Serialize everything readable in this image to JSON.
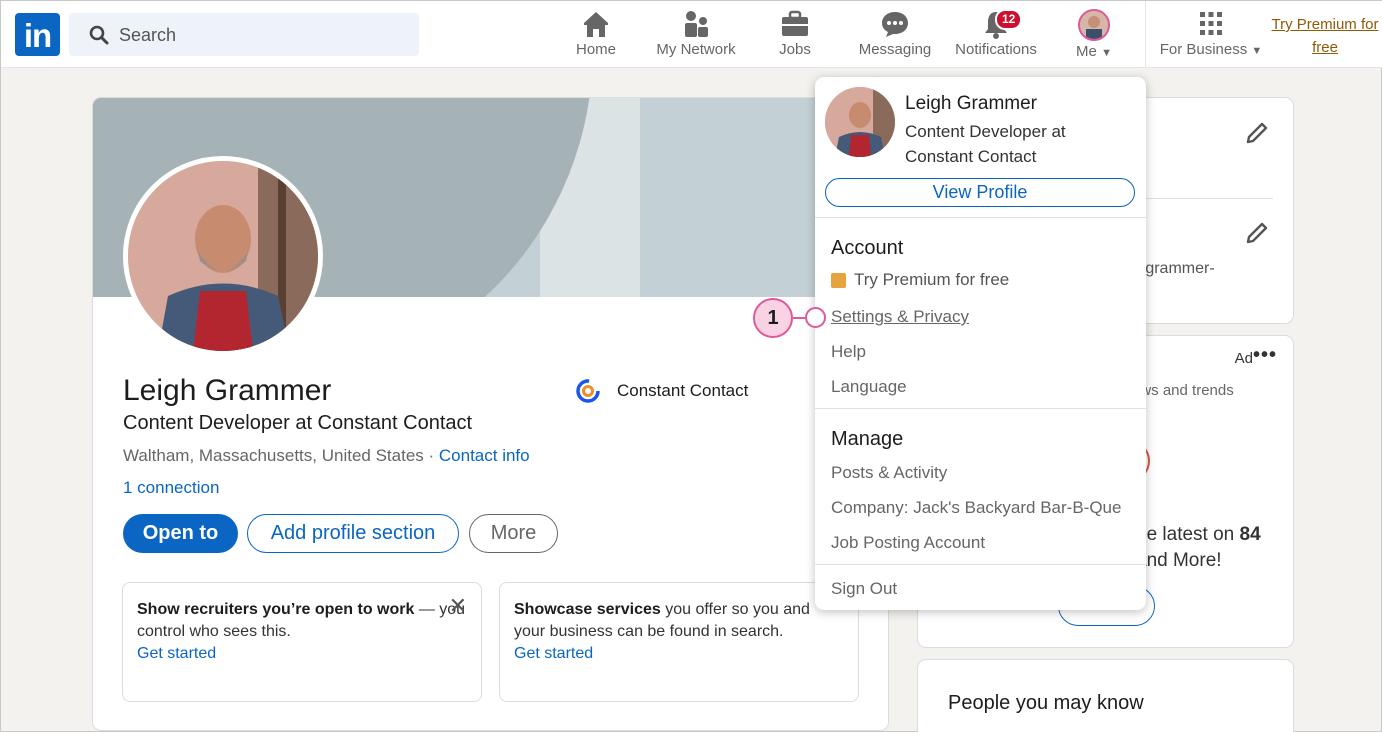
{
  "nav": {
    "logo_text": "in",
    "search_placeholder": "Search",
    "items": [
      {
        "label": "Home"
      },
      {
        "label": "My Network"
      },
      {
        "label": "Jobs"
      },
      {
        "label": "Messaging"
      },
      {
        "label": "Notifications",
        "badge": "12"
      },
      {
        "label": "Me"
      },
      {
        "label": "For Business"
      }
    ],
    "premium_link": "Try Premium for free"
  },
  "profile": {
    "name": "Leigh Grammer",
    "headline": "Content Developer at Constant Contact",
    "location": "Waltham, Massachusetts, United States · ",
    "contact_info": "Contact info",
    "connections": "1 connection",
    "company": "Constant Contact",
    "buttons": {
      "open_to": "Open to",
      "add_section": "Add profile section",
      "more": "More"
    },
    "tips": [
      {
        "bold": "Show recruiters you’re open to work",
        "text": " — you control who sees this.",
        "link": "Get started"
      },
      {
        "bold": "Showcase services",
        "text": " you offer so you and your business can be found in search.",
        "link": "Get started"
      }
    ]
  },
  "right": {
    "url_fragment": "-grammer-",
    "ad_label": "Ad",
    "ad_menu": "•••",
    "news_fragment": "ews and trends",
    "latest_line1": "he latest on ",
    "latest_bold": "84",
    "latest_line2": " and More!",
    "people_title": "People you may know"
  },
  "dropdown": {
    "name": "Leigh Grammer",
    "headline": "Content Developer at Constant Contact",
    "view_profile": "View Profile",
    "account_heading": "Account",
    "account_items": [
      "Try Premium for free",
      "Settings & Privacy",
      "Help",
      "Language"
    ],
    "manage_heading": "Manage",
    "manage_items": [
      "Posts & Activity",
      "Company: Jack's Backyard Bar-B-Que",
      "Job Posting Account"
    ],
    "sign_out": "Sign Out"
  },
  "callout": {
    "number": "1"
  },
  "colors": {
    "brand_blue": "#0a66c2",
    "notification_red": "#cb112d",
    "premium_gold": "#915907",
    "callout_pink": "#e0589a"
  }
}
